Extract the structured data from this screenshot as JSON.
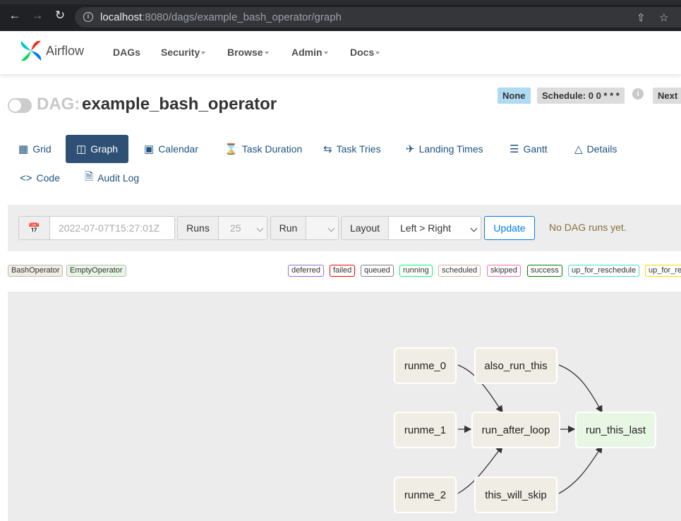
{
  "browser": {
    "url_host": "localhost",
    "url_path": ":8080/dags/example_bash_operator/graph"
  },
  "navbar": {
    "brand": "Airflow",
    "menu": [
      "DAGs",
      "Security",
      "Browse",
      "Admin",
      "Docs"
    ]
  },
  "dag": {
    "label": "DAG:",
    "id": "example_bash_operator",
    "badge_none": "None",
    "badge_schedule": "Schedule: 0 0 * * *",
    "badge_next": "Next"
  },
  "tabs": [
    "Grid",
    "Graph",
    "Calendar",
    "Task Duration",
    "Task Tries",
    "Landing Times",
    "Gantt",
    "Details",
    "Code",
    "Audit Log"
  ],
  "toolbar": {
    "date_placeholder": "2022-07-07T15:27:01Z",
    "runs_label": "Runs",
    "runs_value": "25",
    "run_label": "Run",
    "layout_label": "Layout",
    "layout_value": "Left > Right",
    "update_label": "Update",
    "status": "No DAG runs yet."
  },
  "operators": [
    {
      "name": "BashOperator",
      "color": "#f0ede4"
    },
    {
      "name": "EmptyOperator",
      "color": "#e8f7e4"
    }
  ],
  "states": [
    {
      "name": "deferred",
      "color": "#9370db"
    },
    {
      "name": "failed",
      "color": "#ff0000"
    },
    {
      "name": "queued",
      "color": "#808080"
    },
    {
      "name": "running",
      "color": "#01ff70"
    },
    {
      "name": "scheduled",
      "color": "#d2b48c"
    },
    {
      "name": "skipped",
      "color": "#ff69b4"
    },
    {
      "name": "success",
      "color": "#008000"
    },
    {
      "name": "up_for_reschedule",
      "color": "#40e0d0"
    },
    {
      "name": "up_for_re",
      "color": "#ffd700"
    }
  ],
  "tasks": {
    "runme_0": "runme_0",
    "runme_1": "runme_1",
    "runme_2": "runme_2",
    "also_run_this": "also_run_this",
    "run_after_loop": "run_after_loop",
    "this_will_skip": "this_will_skip",
    "run_this_last": "run_this_last"
  }
}
